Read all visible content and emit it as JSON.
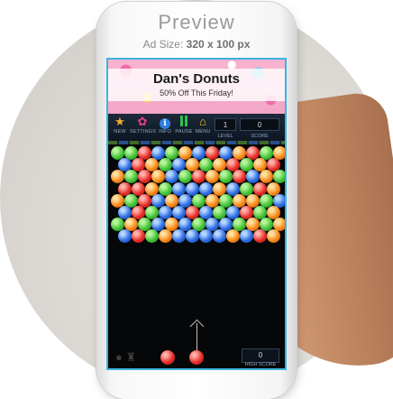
{
  "preview": {
    "title": "Preview",
    "ad_size_label": "Ad Size:",
    "ad_size_value": "320 x 100 px"
  },
  "ad": {
    "title": "Dan's Donuts",
    "subtitle": "50% Off This Friday!"
  },
  "toolbar": {
    "new_label": "NEW",
    "settings_label": "SETTINGS",
    "info_label": "INFO",
    "pause_label": "PAUSE",
    "menu_label": "MENU",
    "level_label": "LEVEL",
    "level_value": "1",
    "score_label": "SCORE",
    "score_value": "0",
    "info_glyph": "i"
  },
  "footer": {
    "high_score_label": "HIGH SCORE",
    "high_score_value": "0"
  },
  "bubble_rows": [
    [
      "green",
      "green",
      "red",
      "blue",
      "green",
      "orange",
      "blue",
      "red",
      "blue",
      "orange",
      "red",
      "green",
      "orange"
    ],
    [
      "blue",
      "red",
      "orange",
      "green",
      "blue",
      "orange",
      "green",
      "orange",
      "red",
      "green",
      "orange",
      "red"
    ],
    [
      "orange",
      "green",
      "red",
      "orange",
      "blue",
      "green",
      "red",
      "orange",
      "green",
      "red",
      "blue",
      "orange",
      "green"
    ],
    [
      "red",
      "red",
      "orange",
      "green",
      "blue",
      "blue",
      "blue",
      "orange",
      "blue",
      "green",
      "red",
      "orange"
    ],
    [
      "orange",
      "green",
      "red",
      "blue",
      "orange",
      "blue",
      "green",
      "orange",
      "green",
      "orange",
      "orange",
      "green",
      "blue"
    ],
    [
      "blue",
      "red",
      "green",
      "blue",
      "blue",
      "red",
      "blue",
      "green",
      "blue",
      "red",
      "green",
      "orange"
    ],
    [
      "green",
      "orange",
      "green",
      "blue",
      "orange",
      "blue",
      "green",
      "blue",
      "blue",
      "green",
      "orange",
      "green",
      "orange"
    ],
    [
      "blue",
      "red",
      "green",
      "orange",
      "blue",
      "blue",
      "blue",
      "blue",
      "orange",
      "blue",
      "red",
      "orange"
    ]
  ],
  "icons": {
    "new": "star-icon",
    "settings": "gear-icon",
    "info": "info-icon",
    "pause": "pause-icon",
    "menu": "home-icon",
    "footer_left": "bomb-icon",
    "footer_right": "trophy-icon"
  },
  "colors": {
    "screen_border": "#3db3e0",
    "ad_background": "#f3a6c6",
    "screen_background": "#050708"
  }
}
